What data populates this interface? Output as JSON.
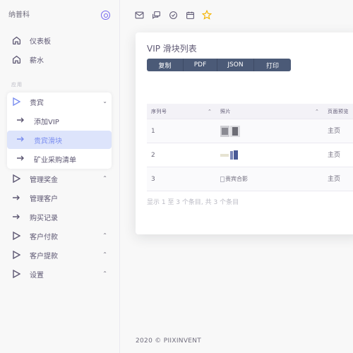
{
  "brand": {
    "name": "纳普科"
  },
  "sidebar": {
    "top_items": [
      {
        "label": "仪表板",
        "icon": "home-icon"
      },
      {
        "label": "薪水",
        "icon": "home-icon"
      }
    ],
    "section_label": "应用",
    "guest": {
      "label": "贵宾",
      "children": [
        {
          "label": "添加VIP"
        },
        {
          "label": "贵宾滑块",
          "active": true
        },
        {
          "label": "矿业采购清单"
        }
      ]
    },
    "bottom_items": [
      {
        "label": "管理奖金",
        "has_children": true
      },
      {
        "label": "管理客户",
        "has_children": false
      },
      {
        "label": "购买记录",
        "has_children": false
      },
      {
        "label": "客户付款",
        "has_children": true
      },
      {
        "label": "客户提款",
        "has_children": true
      },
      {
        "label": "设置",
        "has_children": true
      }
    ]
  },
  "topbar": {
    "icons": [
      "mail-icon",
      "chat-icon",
      "check-circle-icon",
      "calendar-icon",
      "star-icon"
    ]
  },
  "card": {
    "title": "VIP 滑块列表",
    "buttons": [
      "复制",
      "PDF",
      "JSON",
      "打印"
    ],
    "columns": [
      "序列号",
      "照片",
      "页面预览"
    ],
    "rows": [
      {
        "serial": "1",
        "photo": "",
        "preview": "主页"
      },
      {
        "serial": "2",
        "photo": "",
        "preview": "主页"
      },
      {
        "serial": "3",
        "photo": "贵宾合影",
        "preview": "主页"
      }
    ],
    "pager": "显示 1 至 3 个条目, 共 3 个条目"
  },
  "footer": {
    "text": "2020 © PIIXINVENT"
  },
  "colors": {
    "accent": "#7367f0",
    "button": "#4b5a77",
    "active_bg": "#dde4fb"
  }
}
